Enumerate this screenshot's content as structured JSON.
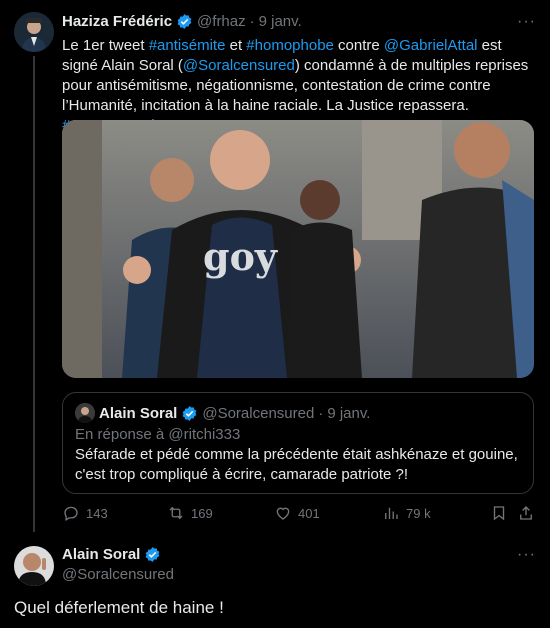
{
  "tweet1": {
    "author_name": "Haziza Frédéric",
    "author_handle": "@frhaz",
    "separator": "·",
    "date": "9 janv.",
    "more": "···",
    "text_parts": [
      {
        "t": "Le 1er tweet ",
        "link": false
      },
      {
        "t": "#antisémite",
        "link": true
      },
      {
        "t": " et ",
        "link": false
      },
      {
        "t": "#homophobe",
        "link": true
      },
      {
        "t": " contre ",
        "link": false
      },
      {
        "t": "@GabrielAttal",
        "link": true
      },
      {
        "t": " est signé Alain Soral  (",
        "link": false
      },
      {
        "t": "@Soralcensured",
        "link": true
      },
      {
        "t": ") condamné à de multiples reprises pour antisémitisme, négationnisme, contestation de crime contre l’Humanité, incitation à la haine raciale. La Justice repassera. ",
        "link": false
      },
      {
        "t": "#ABonEntendeur",
        "link": true
      },
      {
        "t": " !",
        "link": false
      }
    ],
    "media_shirt_text": "goy",
    "quote": {
      "author_name": "Alain Soral",
      "author_handle": "@Soralcensured",
      "separator": "·",
      "date": "9 janv.",
      "reply_to": "En réponse à @ritchi333",
      "text": "Séfarade et pédé comme la précédente était ashkénaze et gouine, c'est trop compliqué à écrire, camarade patriote ?!"
    },
    "stats": {
      "replies": "143",
      "retweets": "169",
      "likes": "401",
      "views": "79 k"
    }
  },
  "tweet2": {
    "author_name": "Alain Soral",
    "author_handle": "@Soralcensured",
    "more": "···",
    "text": "Quel déferlement de haine !"
  },
  "colors": {
    "background": "#000000",
    "text": "#e7e9ea",
    "muted": "#71767b",
    "link": "#1d9bf0",
    "border": "#333639"
  }
}
